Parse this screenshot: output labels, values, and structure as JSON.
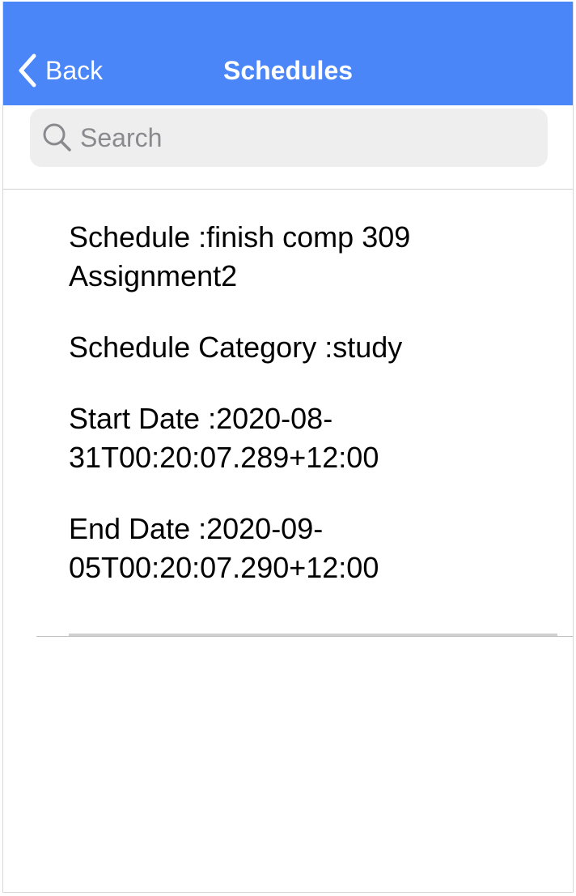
{
  "navbar": {
    "back_label": "Back",
    "title": "Schedules",
    "background_color": "#4a86f7",
    "back_icon": "chevron-left-icon"
  },
  "search": {
    "placeholder": "Search",
    "value": "",
    "icon": "search-icon"
  },
  "schedules": [
    {
      "schedule_text": "Schedule :finish comp 309 Assignment2",
      "category_text": "Schedule Category :study",
      "start_date_text": "Start Date :2020-08-31T00:20:07.289+12:00",
      "end_date_text": "End Date :2020-09-05T00:20:07.290+12:00"
    }
  ]
}
